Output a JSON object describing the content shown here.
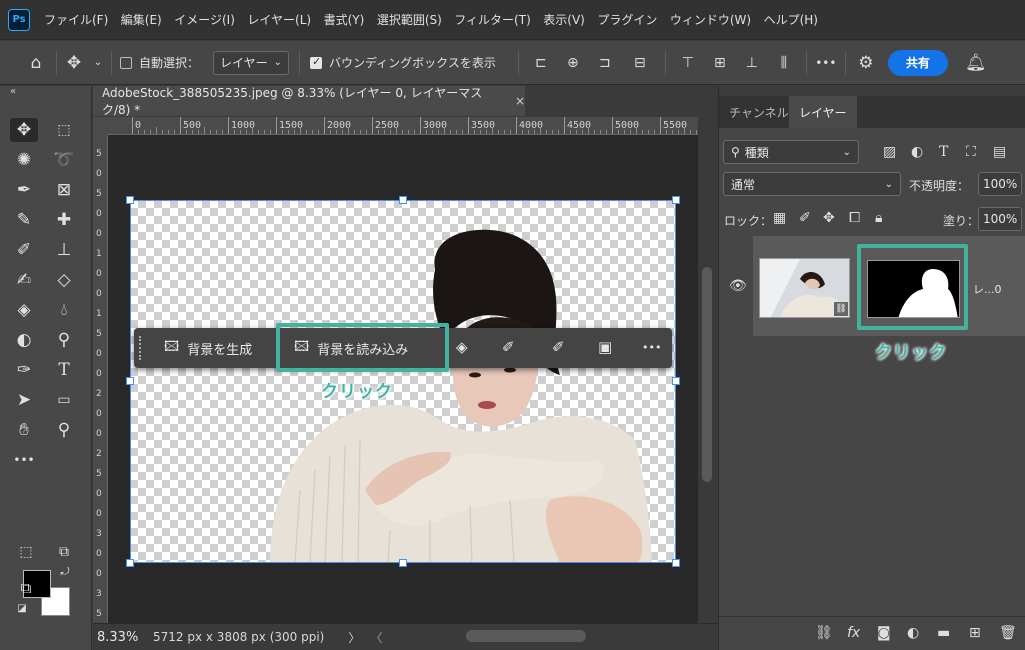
{
  "app": {
    "logo": "Ps"
  },
  "menu": [
    "ファイル(F)",
    "編集(E)",
    "イメージ(I)",
    "レイヤー(L)",
    "書式(Y)",
    "選択範囲(S)",
    "フィルター(T)",
    "表示(V)",
    "プラグイン",
    "ウィンドウ(W)",
    "ヘルプ(H)"
  ],
  "options": {
    "auto_select_label": "自動選択：",
    "auto_select_target": "レイヤー",
    "bbox_label": "バウンディングボックスを表示",
    "share_label": "共有",
    "more": "•••"
  },
  "document": {
    "tab_title": "AdobeStock_388505235.jpeg @ 8.33% (レイヤー 0, レイヤーマスク/8) *",
    "close": "×",
    "ruler_top": [
      "0",
      "500",
      "1000",
      "1500",
      "2000",
      "2500",
      "3000",
      "3500",
      "4000",
      "4500",
      "5000",
      "5500"
    ],
    "ruler_left": [
      "5",
      "0",
      "5",
      "0",
      "0",
      "1",
      "0",
      "0",
      "1",
      "5",
      "0",
      "0",
      "2",
      "0",
      "0",
      "2",
      "5",
      "0",
      "0",
      "3",
      "0",
      "0",
      "3",
      "5"
    ],
    "zoom": "8.33%",
    "doc_info": "5712 px x 3808 px (300 ppi)",
    "status_arrow": "〉",
    "scroll_left": "〈"
  },
  "taskbar": {
    "generate_bg": "背景を生成",
    "import_bg": "背景を読み込み",
    "more": "•••"
  },
  "annotations": {
    "click_canvas": "クリック",
    "click_mask": "クリック"
  },
  "layers_panel": {
    "tabs": [
      "チャンネル",
      "レイヤー"
    ],
    "filter_kind": "種類",
    "blend_mode": "通常",
    "opacity_label": "不透明度：",
    "opacity_value": "100%",
    "lock_label": "ロック：",
    "fill_label": "塗り：",
    "fill_value": "100%",
    "layer_name": "レ...0"
  },
  "colors": {
    "accent_teal": "#43b3a0",
    "share_blue": "#1473e6",
    "selection_blue": "#4a8ff0"
  }
}
